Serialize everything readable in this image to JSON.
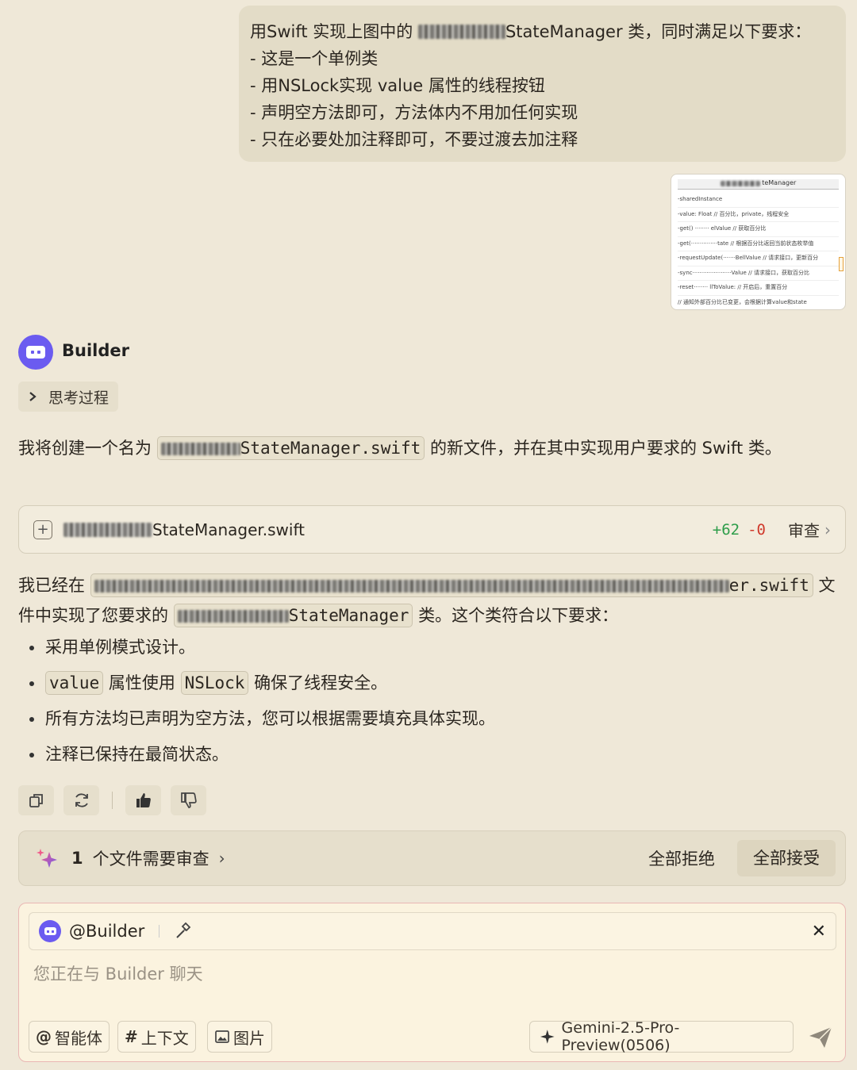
{
  "user_message": {
    "line1_prefix": "用Swift 实现上图中的",
    "line1_suffix": "StateManager 类，同时满足以下要求：",
    "requirements": [
      "- 这是一个单例类",
      "- 用NSLock实现 value 属性的线程按钮",
      "- 声明空方法即可，方法体内不用加任何实现",
      "- 只在必要处加注释即可，不要过渡去加注释"
    ]
  },
  "attachment": {
    "title": "teManager",
    "rows": [
      "-sharedInstance",
      "-value: Float // 百分比，private，线程安全",
      "-get() ········ elValue // 获取百分比",
      "-get(···············tate // 根据百分比返回当前状态枚举值",
      "-requestUpdate(·······BellValue // 请求接口，更新百分",
      "-sync······················Value // 请求接口，获取百分比",
      "-reset········ llToValue: // 开启后，重置百分",
      "// 通知外部百分比已变更，会根据计算value和state"
    ]
  },
  "agent": {
    "name": "Builder",
    "thinking_label": "思考过程"
  },
  "response": {
    "p1_prefix": "我将创建一个名为",
    "p1_code": "StateManager.swift",
    "p1_suffix": "的新文件，并在其中实现用户要求的 Swift 类。",
    "file_card": {
      "filename": "StateManager.swift",
      "additions": "+62",
      "deletions": "-0",
      "review_label": "审查"
    },
    "p2_prefix": "我已经在",
    "p2_path": "er.swift",
    "p2_middle": "文件中实现了您要求的",
    "p2_class": "StateManager",
    "p2_suffix": "类。这个类符合以下要求：",
    "bullet1": "采用单例模式设计。",
    "bullet2_code1": "value",
    "bullet2_mid": "属性使用",
    "bullet2_code2": "NSLock",
    "bullet2_suffix": "确保了线程安全。",
    "bullet3": "所有方法均已声明为空方法，您可以根据需要填充具体实现。",
    "bullet4": "注释已保持在最简状态。"
  },
  "review_bar": {
    "count": "1",
    "message": "个文件需要审查",
    "reject_all": "全部拒绝",
    "accept_all": "全部接受"
  },
  "composer": {
    "mention": "@Builder",
    "placeholder": "您正在与 Builder 聊天",
    "tools": {
      "agent": "智能体",
      "context": "上下文",
      "image": "图片"
    },
    "model": "Gemini-2.5-Pro-Preview(0506)"
  },
  "colors": {
    "background": "#efe8d8",
    "accent": "#6b5bf0",
    "additions": "#2e9d4a",
    "deletions": "#d0392b"
  }
}
